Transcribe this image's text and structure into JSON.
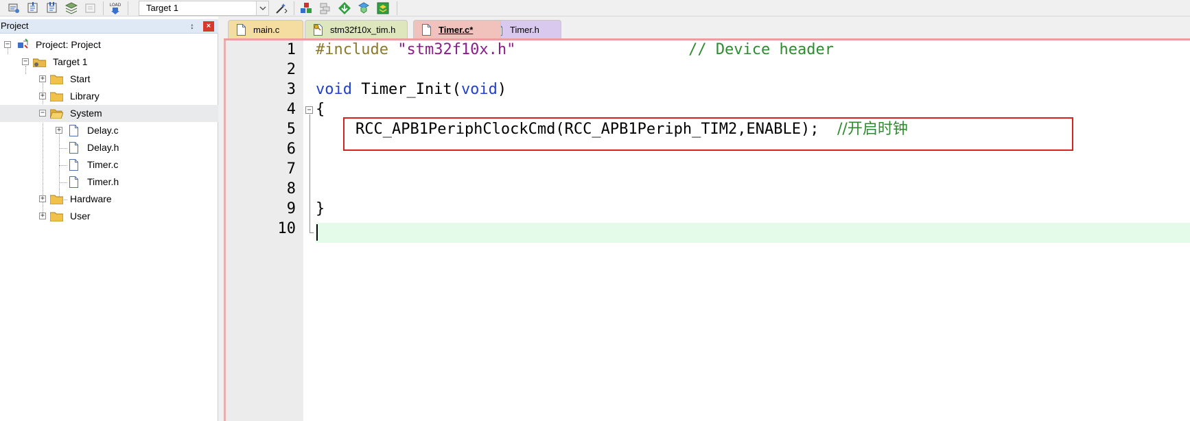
{
  "toolbar": {
    "target_value": "Target 1",
    "load_label": "LOAD"
  },
  "project_panel": {
    "title": "Project",
    "pin_glyph": "↕",
    "close_glyph": "×",
    "tree": {
      "root": "Project: Project",
      "target": "Target 1",
      "groups": [
        "Start",
        "Library",
        "System",
        "Hardware",
        "User"
      ],
      "system_files": [
        "Delay.c",
        "Delay.h",
        "Timer.c",
        "Timer.h"
      ]
    }
  },
  "tabs": [
    {
      "label": "main.c"
    },
    {
      "label": "stm32f10x_tim.h"
    },
    {
      "label": "Timer.c*"
    },
    {
      "label": "Timer.h"
    }
  ],
  "editor": {
    "line_numbers": [
      "1",
      "2",
      "3",
      "4",
      "5",
      "6",
      "7",
      "8",
      "9",
      "10"
    ],
    "line1": {
      "directive": "#include",
      "string": "\"stm32f10x.h\"",
      "comment": "// Device header"
    },
    "line3": {
      "kw1": "void",
      "name": " Timer_Init(",
      "kw2": "void",
      "close": ")"
    },
    "line4": "{",
    "line5": {
      "code": "RCC_APB1PeriphClockCmd(RCC_APB1Periph_TIM2,ENABLE);",
      "comment": "//开启时钟"
    },
    "line9": "}"
  },
  "colors": {
    "preprocessor": "#8b7a2b",
    "string": "#8b1c8b",
    "comment": "#2e8b2e",
    "keyword": "#1f3fd6",
    "current_line": "#e3fbe8",
    "highlight_box": "#d32020"
  }
}
